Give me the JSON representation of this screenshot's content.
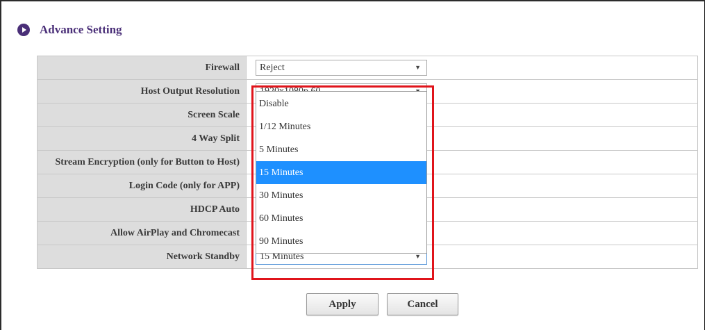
{
  "section": {
    "title": "Advance Setting",
    "icon": "play-circle-icon",
    "accent_color": "#4a2f78"
  },
  "rows": [
    {
      "label": "Firewall",
      "value": "Reject"
    },
    {
      "label": "Host Output Resolution",
      "value": "1920x1080p 60"
    },
    {
      "label": "Screen Scale",
      "value": ""
    },
    {
      "label": "4 Way Split",
      "value": ""
    },
    {
      "label": "Stream Encryption (only for Button to Host)",
      "value": ""
    },
    {
      "label": "Login Code (only for APP)",
      "value": ""
    },
    {
      "label": "HDCP Auto",
      "value": ""
    },
    {
      "label": "Allow AirPlay and Chromecast",
      "value": ""
    },
    {
      "label": "Network Standby",
      "value": "15 Minutes"
    }
  ],
  "dropdown": {
    "options": [
      "Disable",
      "1/12 Minutes",
      "5 Minutes",
      "15 Minutes",
      "30 Minutes",
      "60 Minutes",
      "90 Minutes"
    ],
    "selected": "15 Minutes",
    "selected_color": "#1e90ff",
    "highlight_color": "#e0141b"
  },
  "buttons": {
    "apply": "Apply",
    "cancel": "Cancel"
  }
}
